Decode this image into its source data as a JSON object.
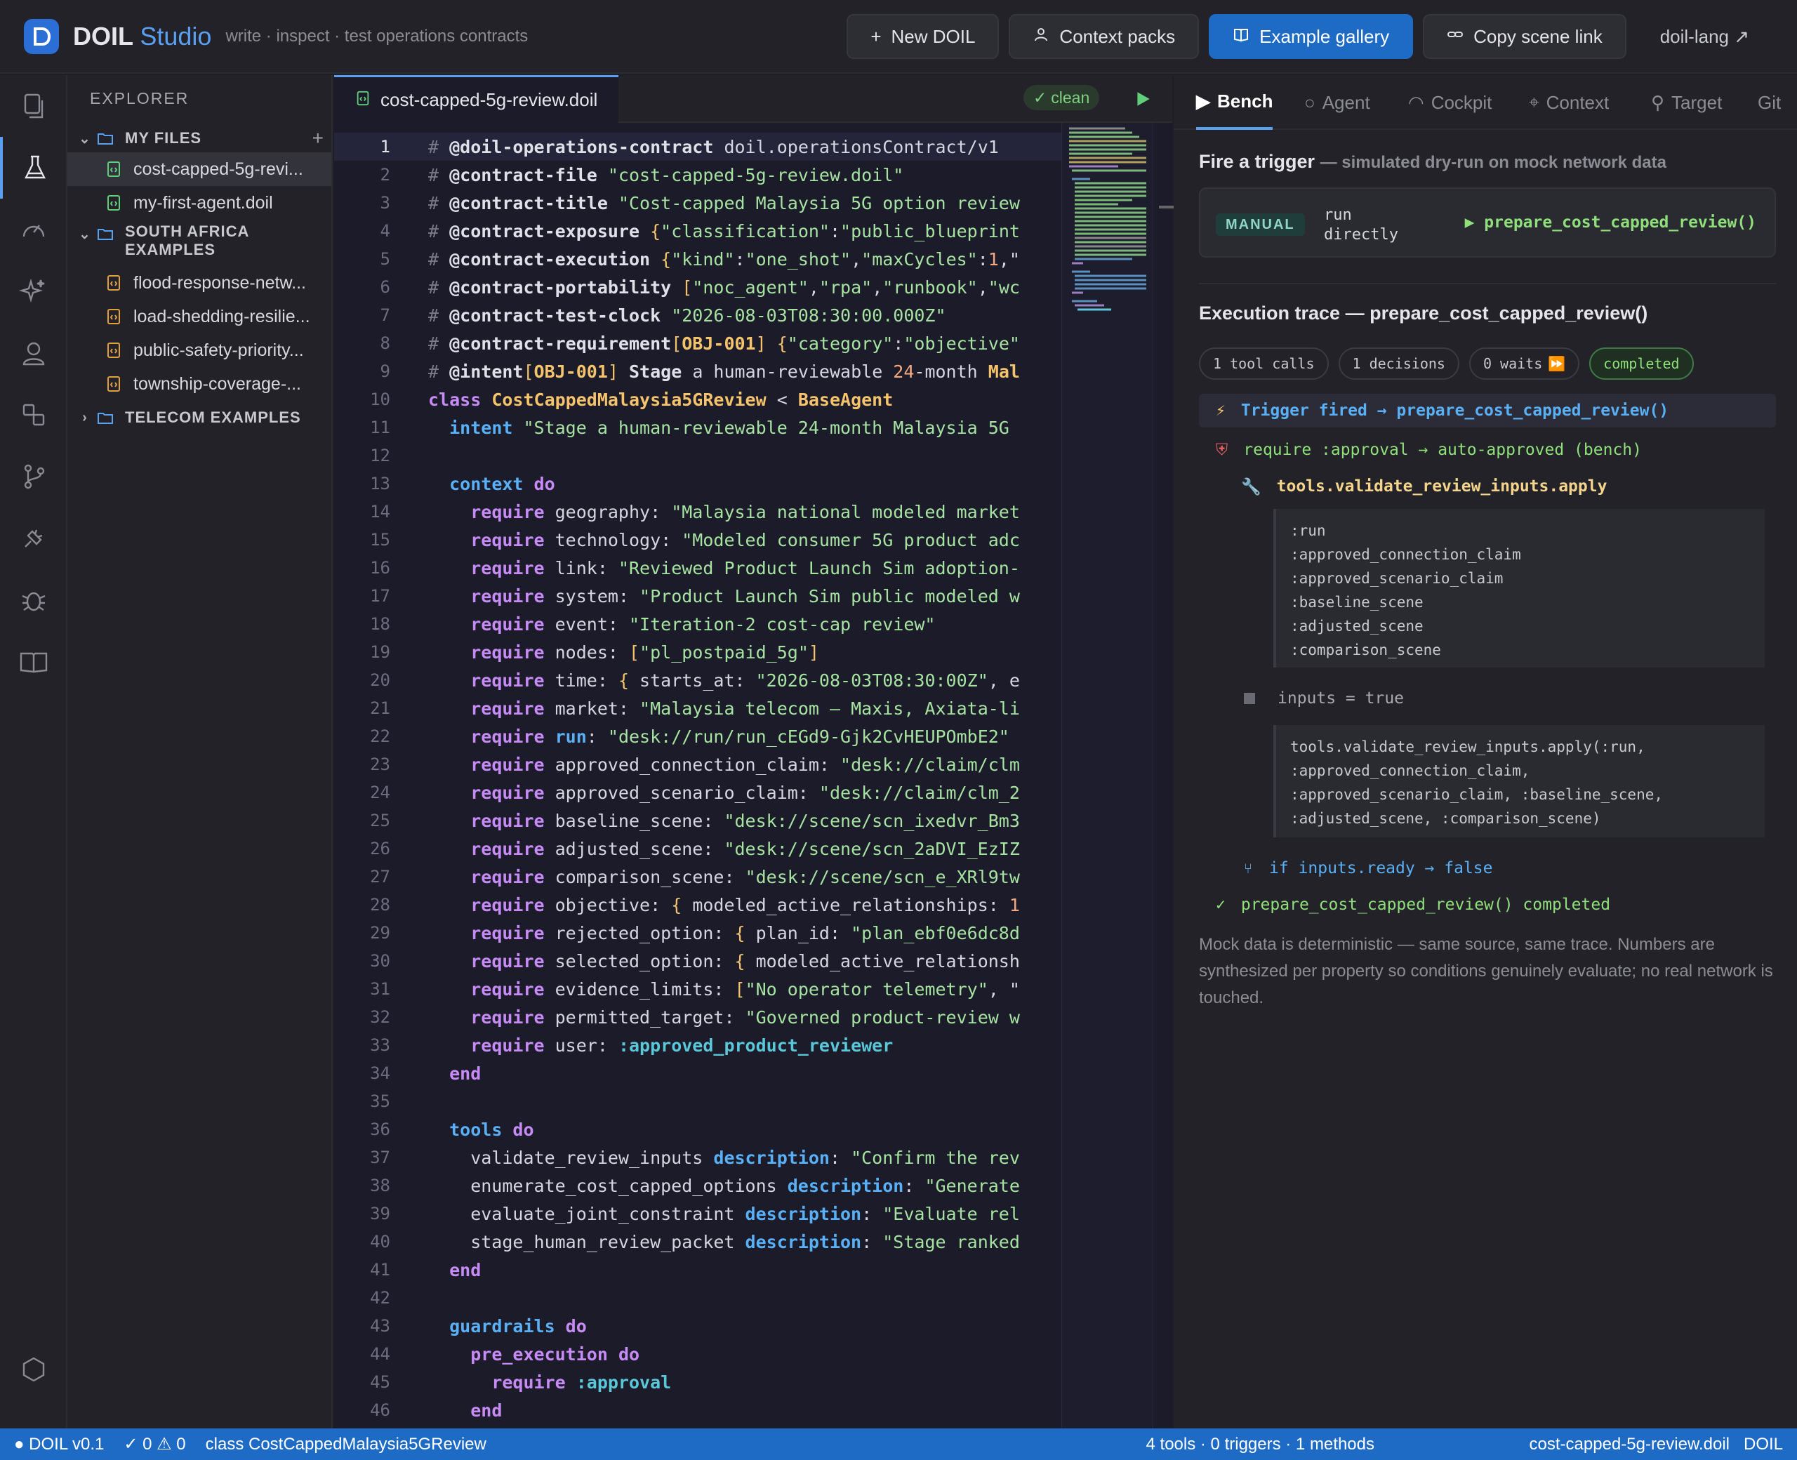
{
  "header": {
    "brand": "DOIL",
    "brand_suffix": "Studio",
    "tagline": "write · inspect · test operations contracts",
    "buttons": {
      "new_doil": "New DOIL",
      "context_packs": "Context packs",
      "example_gallery": "Example gallery",
      "copy_scene_link": "Copy scene link",
      "doil_lang": "doil-lang ↗"
    }
  },
  "explorer": {
    "title": "EXPLORER",
    "my_files": {
      "label": "MY FILES",
      "files": [
        "cost-capped-5g-revi...",
        "my-first-agent.doil"
      ]
    },
    "south_africa": {
      "label_line1": "SOUTH AFRICA",
      "label_line2": "EXAMPLES",
      "files": [
        "flood-response-netw...",
        "load-shedding-resilie...",
        "public-safety-priority...",
        "township-coverage-..."
      ]
    },
    "telecom": {
      "label": "TELECOM EXAMPLES"
    }
  },
  "editor": {
    "tab": "cost-capped-5g-review.doil",
    "status_badge": "clean",
    "line_numbers": [
      "1",
      "2",
      "3",
      "4",
      "5",
      "6",
      "7",
      "8",
      "9",
      "10",
      "11",
      "12",
      "13",
      "14",
      "15",
      "16",
      "17",
      "18",
      "19",
      "20",
      "21",
      "22",
      "23",
      "24",
      "25",
      "26",
      "27",
      "28",
      "29",
      "30",
      "31",
      "32",
      "33",
      "34",
      "35",
      "36",
      "37",
      "38",
      "39",
      "40",
      "41",
      "42",
      "43",
      "44",
      "45",
      "46"
    ],
    "lines": [
      [
        [
          "cmt",
          "# "
        ],
        [
          "dir",
          "@doil-operations-contract"
        ],
        [
          "plain",
          " doil.operationsContract/v1"
        ]
      ],
      [
        [
          "cmt",
          "# "
        ],
        [
          "dir",
          "@contract-file"
        ],
        [
          "str",
          " \"cost-capped-5g-review.doil\""
        ]
      ],
      [
        [
          "cmt",
          "# "
        ],
        [
          "dir",
          "@contract-title"
        ],
        [
          "str",
          " \"Cost-capped Malaysia 5G option review"
        ]
      ],
      [
        [
          "cmt",
          "# "
        ],
        [
          "dir",
          "@contract-exposure"
        ],
        [
          "punc",
          " {"
        ],
        [
          "str",
          "\"classification\""
        ],
        [
          "plain",
          ":"
        ],
        [
          "str",
          "\"public_blueprint"
        ]
      ],
      [
        [
          "cmt",
          "# "
        ],
        [
          "dir",
          "@contract-execution"
        ],
        [
          "punc",
          " {"
        ],
        [
          "str",
          "\"kind\""
        ],
        [
          "plain",
          ":"
        ],
        [
          "str",
          "\"one_shot\""
        ],
        [
          "plain",
          ","
        ],
        [
          "str",
          "\"maxCycles\""
        ],
        [
          "plain",
          ":"
        ],
        [
          "num",
          "1"
        ],
        [
          "plain",
          ",\""
        ]
      ],
      [
        [
          "cmt",
          "# "
        ],
        [
          "dir",
          "@contract-portability"
        ],
        [
          "punc",
          " ["
        ],
        [
          "str",
          "\"noc_agent\""
        ],
        [
          "plain",
          ","
        ],
        [
          "str",
          "\"rpa\""
        ],
        [
          "plain",
          ","
        ],
        [
          "str",
          "\"runbook\""
        ],
        [
          "plain",
          ","
        ],
        [
          "str",
          "\"wc"
        ]
      ],
      [
        [
          "cmt",
          "# "
        ],
        [
          "dir",
          "@contract-test-clock"
        ],
        [
          "str",
          " \"2026-08-03T08:30:00.000Z\""
        ]
      ],
      [
        [
          "cmt",
          "# "
        ],
        [
          "dir",
          "@contract-requirement"
        ],
        [
          "punc",
          "["
        ],
        [
          "cls",
          "OBJ-001"
        ],
        [
          "punc",
          "]"
        ],
        [
          "punc",
          " {"
        ],
        [
          "str",
          "\"category\""
        ],
        [
          "plain",
          ":"
        ],
        [
          "str",
          "\"objective\""
        ]
      ],
      [
        [
          "cmt",
          "# "
        ],
        [
          "dir",
          "@intent"
        ],
        [
          "punc",
          "["
        ],
        [
          "cls",
          "OBJ-001"
        ],
        [
          "punc",
          "]"
        ],
        [
          "dir",
          " Stage"
        ],
        [
          "plain",
          " a human-reviewable "
        ],
        [
          "num",
          "24"
        ],
        [
          "plain",
          "-month "
        ],
        [
          "cls",
          "Mal"
        ]
      ],
      [
        [
          "kw2",
          "class"
        ],
        [
          "cls",
          " CostCappedMalaysia5GReview"
        ],
        [
          "plain",
          " < "
        ],
        [
          "cls",
          "BaseAgent"
        ]
      ],
      [
        [
          "plain",
          "  "
        ],
        [
          "kw",
          "intent"
        ],
        [
          "str",
          " \"Stage a human-reviewable 24-month Malaysia 5G"
        ]
      ],
      [
        [
          "plain",
          ""
        ]
      ],
      [
        [
          "plain",
          "  "
        ],
        [
          "kw",
          "context"
        ],
        [
          "kw2",
          " do"
        ]
      ],
      [
        [
          "plain",
          "    "
        ],
        [
          "kw2",
          "require"
        ],
        [
          "plain",
          " geography: "
        ],
        [
          "str",
          "\"Malaysia national modeled market"
        ]
      ],
      [
        [
          "plain",
          "    "
        ],
        [
          "kw2",
          "require"
        ],
        [
          "plain",
          " technology: "
        ],
        [
          "str",
          "\"Modeled consumer 5G product adc"
        ]
      ],
      [
        [
          "plain",
          "    "
        ],
        [
          "kw2",
          "require"
        ],
        [
          "plain",
          " link: "
        ],
        [
          "str",
          "\"Reviewed Product Launch Sim adoption-"
        ]
      ],
      [
        [
          "plain",
          "    "
        ],
        [
          "kw2",
          "require"
        ],
        [
          "plain",
          " system: "
        ],
        [
          "str",
          "\"Product Launch Sim public modeled w"
        ]
      ],
      [
        [
          "plain",
          "    "
        ],
        [
          "kw2",
          "require"
        ],
        [
          "plain",
          " event: "
        ],
        [
          "str",
          "\"Iteration-2 cost-cap review\""
        ]
      ],
      [
        [
          "plain",
          "    "
        ],
        [
          "kw2",
          "require"
        ],
        [
          "plain",
          " nodes: "
        ],
        [
          "punc",
          "["
        ],
        [
          "str",
          "\"pl_postpaid_5g\""
        ],
        [
          "punc",
          "]"
        ]
      ],
      [
        [
          "plain",
          "    "
        ],
        [
          "kw2",
          "require"
        ],
        [
          "plain",
          " time: "
        ],
        [
          "punc",
          "{"
        ],
        [
          "plain",
          " starts_at: "
        ],
        [
          "str",
          "\"2026-08-03T08:30:00Z\""
        ],
        [
          "plain",
          ", e"
        ]
      ],
      [
        [
          "plain",
          "    "
        ],
        [
          "kw2",
          "require"
        ],
        [
          "plain",
          " market: "
        ],
        [
          "str",
          "\"Malaysia telecom — Maxis, Axiata-li"
        ]
      ],
      [
        [
          "plain",
          "    "
        ],
        [
          "kw2",
          "require"
        ],
        [
          "kw",
          " run"
        ],
        [
          "plain",
          ": "
        ],
        [
          "str",
          "\"desk://run/run_cEGd9-Gjk2CvHEUPOmbE2\""
        ]
      ],
      [
        [
          "plain",
          "    "
        ],
        [
          "kw2",
          "require"
        ],
        [
          "plain",
          " approved_connection_claim: "
        ],
        [
          "str",
          "\"desk://claim/clm"
        ]
      ],
      [
        [
          "plain",
          "    "
        ],
        [
          "kw2",
          "require"
        ],
        [
          "plain",
          " approved_scenario_claim: "
        ],
        [
          "str",
          "\"desk://claim/clm_2"
        ]
      ],
      [
        [
          "plain",
          "    "
        ],
        [
          "kw2",
          "require"
        ],
        [
          "plain",
          " baseline_scene: "
        ],
        [
          "str",
          "\"desk://scene/scn_ixedvr_Bm3"
        ]
      ],
      [
        [
          "plain",
          "    "
        ],
        [
          "kw2",
          "require"
        ],
        [
          "plain",
          " adjusted_scene: "
        ],
        [
          "str",
          "\"desk://scene/scn_2aDVI_EzIZ"
        ]
      ],
      [
        [
          "plain",
          "    "
        ],
        [
          "kw2",
          "require"
        ],
        [
          "plain",
          " comparison_scene: "
        ],
        [
          "str",
          "\"desk://scene/scn_e_XRl9tw"
        ]
      ],
      [
        [
          "plain",
          "    "
        ],
        [
          "kw2",
          "require"
        ],
        [
          "plain",
          " objective: "
        ],
        [
          "punc",
          "{"
        ],
        [
          "plain",
          " modeled_active_relationships: "
        ],
        [
          "num",
          "1"
        ]
      ],
      [
        [
          "plain",
          "    "
        ],
        [
          "kw2",
          "require"
        ],
        [
          "plain",
          " rejected_option: "
        ],
        [
          "punc",
          "{"
        ],
        [
          "plain",
          " plan_id: "
        ],
        [
          "str",
          "\"plan_ebf0e6dc8d"
        ]
      ],
      [
        [
          "plain",
          "    "
        ],
        [
          "kw2",
          "require"
        ],
        [
          "plain",
          " selected_option: "
        ],
        [
          "punc",
          "{"
        ],
        [
          "plain",
          " modeled_active_relationsh"
        ]
      ],
      [
        [
          "plain",
          "    "
        ],
        [
          "kw2",
          "require"
        ],
        [
          "plain",
          " evidence_limits: "
        ],
        [
          "punc",
          "["
        ],
        [
          "str",
          "\"No operator telemetry\""
        ],
        [
          "plain",
          ", \""
        ]
      ],
      [
        [
          "plain",
          "    "
        ],
        [
          "kw2",
          "require"
        ],
        [
          "plain",
          " permitted_target: "
        ],
        [
          "str",
          "\"Governed product-review w"
        ]
      ],
      [
        [
          "plain",
          "    "
        ],
        [
          "kw2",
          "require"
        ],
        [
          "plain",
          " user: "
        ],
        [
          "sym",
          ":approved_product_reviewer"
        ]
      ],
      [
        [
          "plain",
          "  "
        ],
        [
          "kw2",
          "end"
        ]
      ],
      [
        [
          "plain",
          ""
        ]
      ],
      [
        [
          "plain",
          "  "
        ],
        [
          "kw",
          "tools"
        ],
        [
          "kw2",
          " do"
        ]
      ],
      [
        [
          "plain",
          "    validate_review_inputs "
        ],
        [
          "kw",
          "description"
        ],
        [
          "plain",
          ": "
        ],
        [
          "str",
          "\"Confirm the rev"
        ]
      ],
      [
        [
          "plain",
          "    enumerate_cost_capped_options "
        ],
        [
          "kw",
          "description"
        ],
        [
          "plain",
          ": "
        ],
        [
          "str",
          "\"Generate"
        ]
      ],
      [
        [
          "plain",
          "    evaluate_joint_constraint "
        ],
        [
          "kw",
          "description"
        ],
        [
          "plain",
          ": "
        ],
        [
          "str",
          "\"Evaluate rel"
        ]
      ],
      [
        [
          "plain",
          "    stage_human_review_packet "
        ],
        [
          "kw",
          "description"
        ],
        [
          "plain",
          ": "
        ],
        [
          "str",
          "\"Stage ranked"
        ]
      ],
      [
        [
          "plain",
          "  "
        ],
        [
          "kw2",
          "end"
        ]
      ],
      [
        [
          "plain",
          ""
        ]
      ],
      [
        [
          "plain",
          "  "
        ],
        [
          "kw",
          "guardrails"
        ],
        [
          "kw2",
          " do"
        ]
      ],
      [
        [
          "plain",
          "    "
        ],
        [
          "kw2",
          "pre_execution"
        ],
        [
          "kw2",
          " do"
        ]
      ],
      [
        [
          "plain",
          "      "
        ],
        [
          "kw2",
          "require"
        ],
        [
          "sym",
          " :approval"
        ]
      ],
      [
        [
          "plain",
          "    "
        ],
        [
          "kw2",
          "end"
        ]
      ]
    ]
  },
  "panel": {
    "tabs": [
      "Bench",
      "Agent",
      "Cockpit",
      "Context",
      "Target",
      "Git"
    ],
    "fire_title": "Fire a trigger",
    "fire_sub": "— simulated dry-run on mock network data",
    "trigger_badge": "MANUAL",
    "trigger_text_1": "run",
    "trigger_text_2": "directly",
    "trigger_call": "▶ prepare_cost_capped_review()",
    "trace_title": "Execution trace — prepare_cost_capped_review()",
    "chips": {
      "tool_calls": "1 tool calls",
      "decisions": "1 decisions",
      "waits": "0 waits",
      "status": "completed"
    },
    "trace": {
      "fired": "Trigger fired → prepare_cost_capped_review()",
      "require": "require :approval → auto-approved (bench)",
      "tool": "tools.validate_review_inputs.apply",
      "args_box": ":run\n:approved_connection_claim\n:approved_scenario_claim\n:baseline_scene\n:adjusted_scene\n:comparison_scene",
      "assign": "inputs = true",
      "call_box": "tools.validate_review_inputs.apply(:run,\n:approved_connection_claim,\n:approved_scenario_claim, :baseline_scene,\n:adjusted_scene, :comparison_scene)",
      "branch": "if inputs.ready → false",
      "completed": "prepare_cost_capped_review() completed"
    },
    "footnote": "Mock data is deterministic — same source, same trace. Numbers are synthesized per property so conditions genuinely evaluate; no real network is touched."
  },
  "statusbar": {
    "version": "DOIL v0.1",
    "problems": "✓ 0 ⚠ 0",
    "class": "class CostCappedMalaysia5GReview",
    "summary": "4 tools · 0 triggers · 1 methods",
    "file": "cost-capped-5g-review.doil",
    "lang": "DOIL"
  },
  "colors": {
    "accent": "#1d6bc4",
    "keyword": "#5ab0f5",
    "string": "#a6e3a1",
    "class": "#f5c36b",
    "success": "#8fe07a"
  }
}
